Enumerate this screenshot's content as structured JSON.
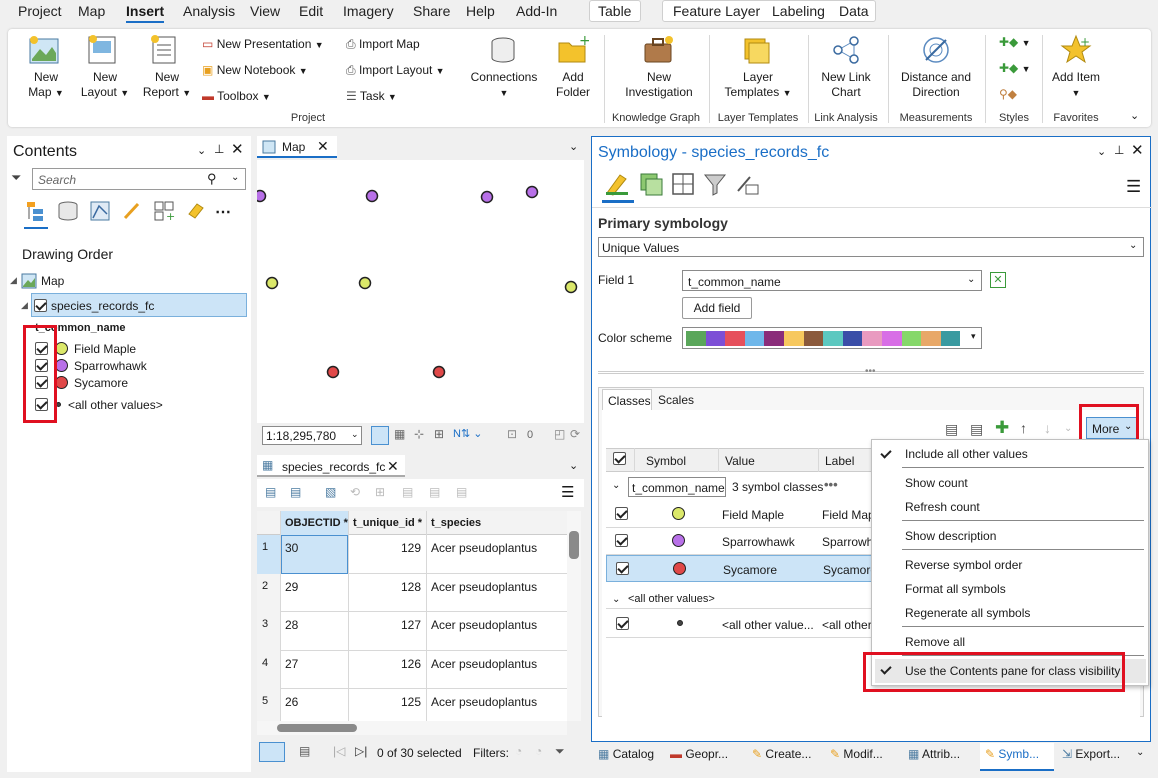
{
  "menubar": {
    "tabs": [
      "Project",
      "Map",
      "Insert",
      "Analysis",
      "View",
      "Edit",
      "Imagery",
      "Share",
      "Help",
      "Add-In"
    ],
    "context_tabs": [
      "Table",
      "Feature Layer",
      "Labeling",
      "Data"
    ]
  },
  "ribbon": {
    "new_map": "New Map",
    "new_layout": "New Layout",
    "new_report": "New Report",
    "new_presentation": "New Presentation",
    "new_notebook": "New Notebook",
    "toolbox": "Toolbox",
    "import_map": "Import Map",
    "import_layout": "Import Layout",
    "task": "Task",
    "connections": "Connections",
    "add_folder": "Add Folder",
    "group_project": "Project",
    "new_investigation": "New Investigation",
    "group_kg": "Knowledge Graph",
    "layer_templates": "Layer Templates",
    "group_lt": "Layer Templates",
    "new_link_chart": "New Link Chart",
    "group_la": "Link Analysis",
    "distance_direction": "Distance and Direction",
    "group_meas": "Measurements",
    "group_styles": "Styles",
    "add_item": "Add Item",
    "group_fav": "Favorites"
  },
  "contents": {
    "title": "Contents",
    "search_placeholder": "Search",
    "drawing_order": "Drawing Order",
    "map": "Map",
    "layer": "species_records_fc",
    "field": "t_common_name",
    "classes": [
      "Field Maple",
      "Sparrowhawk",
      "Sycamore",
      "<all other values>"
    ]
  },
  "map_view": {
    "tab": "Map",
    "scale": "1:18,295,780",
    "grid_count": "0"
  },
  "table": {
    "tab": "species_records_fc",
    "columns": [
      "OBJECTID *",
      "t_unique_id *",
      "t_species"
    ],
    "rows": [
      {
        "n": "1",
        "oid": "30",
        "uid": "129",
        "species": "Acer pseudoplantus"
      },
      {
        "n": "2",
        "oid": "29",
        "uid": "128",
        "species": "Acer pseudoplantus"
      },
      {
        "n": "3",
        "oid": "28",
        "uid": "127",
        "species": "Acer pseudoplantus"
      },
      {
        "n": "4",
        "oid": "27",
        "uid": "126",
        "species": "Acer pseudoplantus"
      },
      {
        "n": "5",
        "oid": "26",
        "uid": "125",
        "species": "Acer pseudoplantus"
      }
    ],
    "selected": "0 of 30 selected",
    "filters": "Filters:"
  },
  "symbology": {
    "title": "Symbology - species_records_fc",
    "primary": "Primary symbology",
    "renderer": "Unique Values",
    "field1_label": "Field 1",
    "field1_value": "t_common_name",
    "add_field": "Add field",
    "color_scheme_label": "Color scheme",
    "color_scheme": [
      "#5aa65a",
      "#7d4fd6",
      "#e6505c",
      "#6fb7ea",
      "#8a2d7a",
      "#f7c85e",
      "#8b5a3c",
      "#5cc8c0",
      "#3a4ea8",
      "#e99ac0",
      "#d86ee6",
      "#86d86a",
      "#e8a868",
      "#3a9aa0"
    ],
    "tabs": [
      "Classes",
      "Scales"
    ],
    "more": "More",
    "headers": [
      "Symbol",
      "Value",
      "Label"
    ],
    "group_field": "t_common_name",
    "group_count": "3 symbol classes",
    "rows": [
      {
        "value": "Field Maple",
        "label": "Field Map",
        "color": "#dbe86a"
      },
      {
        "value": "Sparrowhawk",
        "label": "Sparrowh",
        "color": "#b870e8"
      },
      {
        "value": "Sycamore",
        "label": "Sycamore",
        "color": "#e04848"
      }
    ],
    "other_header": "<all other values>",
    "other_value": "<all other value...",
    "other_label": "<all other"
  },
  "more_menu": {
    "items": [
      "Include all other values",
      "Show count",
      "Refresh count",
      "Show description",
      "Reverse symbol order",
      "Format all symbols",
      "Regenerate all symbols",
      "Remove all",
      "Use the Contents pane for class visibility"
    ]
  },
  "bottom_tabs": [
    "Catalog",
    "Geopr...",
    "Create...",
    "Modif...",
    "Attrib...",
    "Symb...",
    "Export..."
  ]
}
